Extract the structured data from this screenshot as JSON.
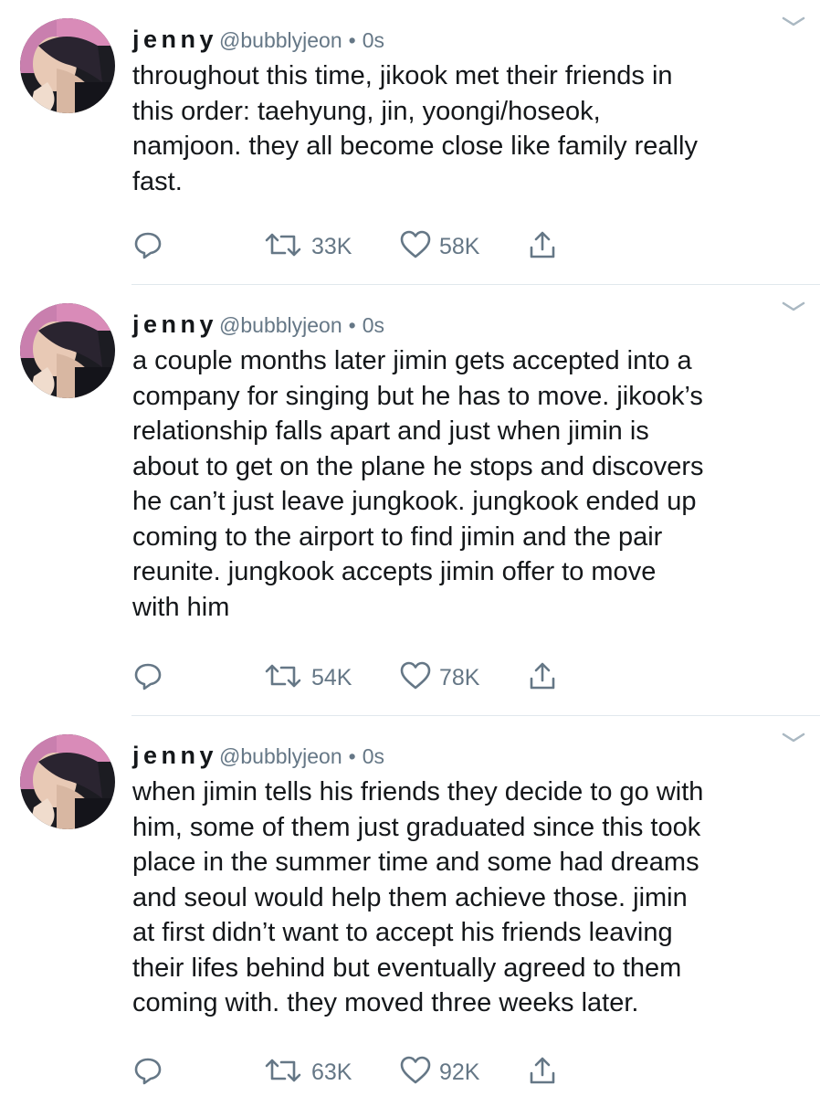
{
  "colors": {
    "text": "#14171a",
    "secondary": "#657786",
    "divider": "#e1e8ed"
  },
  "tweets": [
    {
      "name": "jenny",
      "handle": "@bubblyjeon",
      "separator": "•",
      "time": "0s",
      "text": "throughout this time, jikook met their friends in\nthis order: taehyung, jin, yoongi/hoseok,\nnamjoon. they all become close like family really\nfast.",
      "retweets": "33K",
      "likes": "58K",
      "icons": [
        "reply-icon",
        "retweet-icon",
        "like-icon",
        "share-icon",
        "caret-down-icon"
      ]
    },
    {
      "name": "jenny",
      "handle": "@bubblyjeon",
      "separator": "•",
      "time": "0s",
      "text": "a couple months later jimin gets accepted into a\ncompany for singing but he has to move. jikook’s\nrelationship falls apart and just when jimin is\nabout to get on the plane he stops and discovers\nhe can’t just leave jungkook. jungkook ended up\ncoming to the airport to find jimin and the pair\nreunite. jungkook accepts jimin offer to move\nwith him",
      "retweets": "54K",
      "likes": "78K",
      "icons": [
        "reply-icon",
        "retweet-icon",
        "like-icon",
        "share-icon",
        "caret-down-icon"
      ]
    },
    {
      "name": "jenny",
      "handle": "@bubblyjeon",
      "separator": "•",
      "time": "0s",
      "text": "when jimin tells his friends they decide to go with\nhim, some of them just graduated since this took\nplace in the summer time and some had dreams\nand seoul would help them achieve those. jimin\nat first didn’t want to accept his friends leaving\ntheir lifes behind but eventually agreed to them\ncoming with. they moved three weeks later.",
      "retweets": "63K",
      "likes": "92K",
      "icons": [
        "reply-icon",
        "retweet-icon",
        "like-icon",
        "share-icon",
        "caret-down-icon"
      ]
    }
  ]
}
